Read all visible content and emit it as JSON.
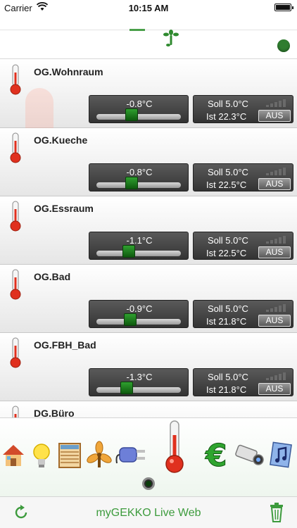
{
  "status_bar": {
    "carrier": "Carrier",
    "time": "10:15 AM"
  },
  "rooms": [
    {
      "name": "OG.Wohnraum",
      "slider_value": "-0.8°C",
      "slider_level": 0.42,
      "soll": "Soll 5.0°C",
      "ist": "Ist  22.3°C",
      "mode": "AUS"
    },
    {
      "name": "OG.Kueche",
      "slider_value": "-0.8°C",
      "slider_level": 0.42,
      "soll": "Soll 5.0°C",
      "ist": "Ist  22.5°C",
      "mode": "AUS"
    },
    {
      "name": "OG.Essraum",
      "slider_value": "-1.1°C",
      "slider_level": 0.38,
      "soll": "Soll 5.0°C",
      "ist": "Ist  22.5°C",
      "mode": "AUS"
    },
    {
      "name": "OG.Bad",
      "slider_value": "-0.9°C",
      "slider_level": 0.4,
      "soll": "Soll 5.0°C",
      "ist": "Ist  21.8°C",
      "mode": "AUS"
    },
    {
      "name": "OG.FBH_Bad",
      "slider_value": "-1.3°C",
      "slider_level": 0.36,
      "soll": "Soll 5.0°C",
      "ist": "Ist  21.8°C",
      "mode": "AUS"
    },
    {
      "name": "DG.Büro",
      "slider_value": "",
      "slider_level": 0.4,
      "soll": "",
      "ist": "",
      "mode": ""
    }
  ],
  "categories": [
    "house-icon",
    "bulb-icon",
    "blinds-icon",
    "fan-icon",
    "plug-icon",
    "thermometer-icon",
    "euro-icon",
    "camera-icon",
    "music-icon"
  ],
  "toolbar": {
    "title": "myGEKKO Live Web"
  },
  "colors": {
    "accent": "#3d9b3d",
    "knob": "#1f7a1f",
    "panel": "#444444"
  }
}
